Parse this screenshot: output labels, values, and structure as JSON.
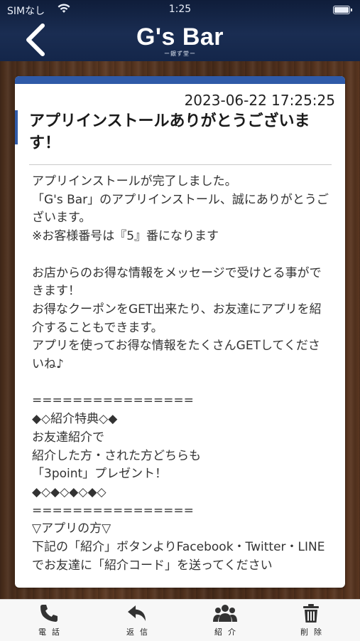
{
  "status_bar": {
    "carrier": "SIMなし",
    "time": "1:25"
  },
  "header": {
    "brand_name": "G's Bar",
    "brand_subtitle": "ー銀ず堂ー"
  },
  "message": {
    "date": "2023-06-22 17:25:25",
    "title": "アプリインストールありがとうございます！",
    "body": "アプリインストールが完了しました。\n「G's Bar」のアプリインストール、誠にありがとうございます。\n※お客様番号は『5』番になります\n\nお店からのお得な情報をメッセージで受けとる事ができます！\nお得なクーポンをGET出来たり、お友達にアプリを紹介することもできます。\nアプリを使ってお得な情報をたくさんGETしてくださいね♪\n\n================\n◆◇紹介特典◇◆\nお友達紹介で\n紹介した方・された方どちらも\n「3point」プレゼント！\n◆◇◆◇◆◇◆◇\n================\n▽アプリの方▽\n下記の「紹介」ボタンよりFacebook・Twitter・LINEでお友達に「紹介コード」を送ってください"
  },
  "tabbar": {
    "items": [
      {
        "label": "電話",
        "icon": "phone-icon"
      },
      {
        "label": "返信",
        "icon": "reply-icon"
      },
      {
        "label": "紹介",
        "icon": "users-icon"
      },
      {
        "label": "削除",
        "icon": "trash-icon"
      }
    ]
  },
  "colors": {
    "header_bg": "#14264a",
    "accent": "#2f5aa8",
    "card_bg": "#ffffff",
    "wood": "#4a2e1c"
  }
}
